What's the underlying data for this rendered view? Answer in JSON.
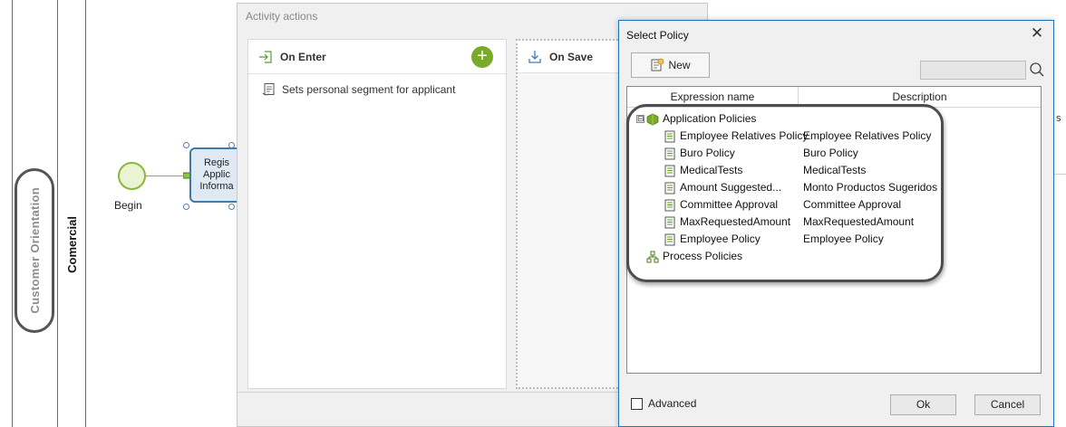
{
  "canvas": {
    "lane_title": "Customer Orientation",
    "lane_subtitle": "Comercial",
    "start_event_label": "Begin",
    "task_label_lines": [
      "Regis",
      "Applic",
      "Informa"
    ]
  },
  "activity_actions": {
    "title": "Activity actions",
    "on_enter": {
      "label": "On Enter",
      "add_label": "+",
      "items": [
        "Sets personal segment for applicant"
      ]
    },
    "on_save": {
      "label": "On Save"
    }
  },
  "select_policy": {
    "title": "Select Policy",
    "close_label": "✕",
    "new_button": "New",
    "search": {
      "value": ""
    },
    "columns": [
      "Expression name",
      "Description"
    ],
    "group_application": {
      "label": "Application Policies",
      "expander": "⊟",
      "items": [
        {
          "name": "Employee Relatives Policy",
          "description": "Employee Relatives Policy"
        },
        {
          "name": "Buro Policy",
          "description": "Buro Policy"
        },
        {
          "name": "MedicalTests",
          "description": "MedicalTests"
        },
        {
          "name": "Amount Suggested...",
          "description": "Monto Productos Sugeridos"
        },
        {
          "name": "Committee Approval",
          "description": "Committee Approval"
        },
        {
          "name": "MaxRequestedAmount",
          "description": "MaxRequestedAmount"
        },
        {
          "name": "Employee Policy",
          "description": "Employee Policy"
        }
      ]
    },
    "group_process": {
      "label": "Process Policies"
    },
    "advanced_label": "Advanced",
    "advanced_checked": false,
    "ok_button": "Ok",
    "cancel_button": "Cancel"
  },
  "right_edge_fragment": "s",
  "colors": {
    "accent_green": "#7aaa2a",
    "dialog_border": "#1e73be",
    "task_border": "#3d7ba8"
  }
}
